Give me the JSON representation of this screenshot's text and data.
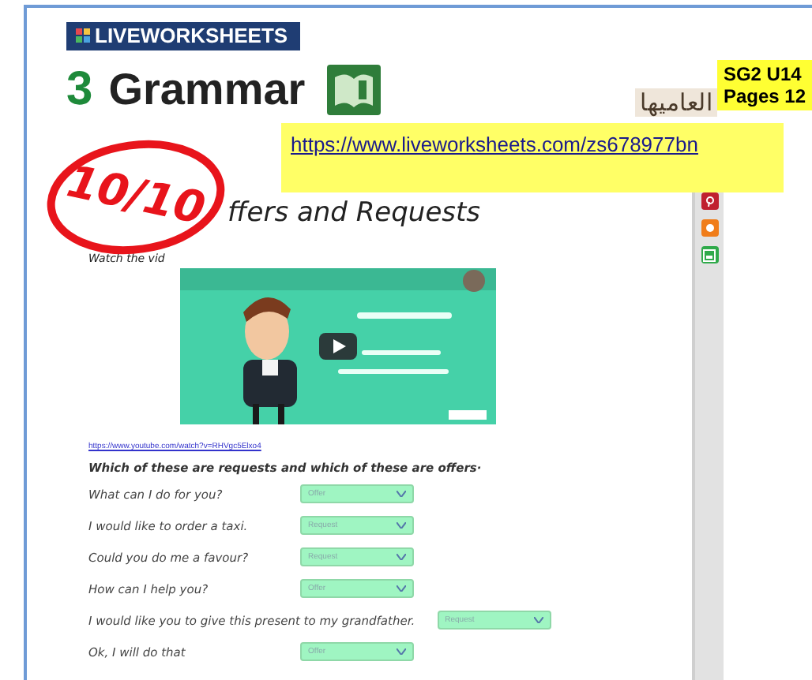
{
  "logo": "LIVEWORKSHEETS",
  "heading": {
    "number": "3",
    "title": "Grammar"
  },
  "arabic_label": "العاميها",
  "note": [
    "SG2 U14",
    "Pages 12"
  ],
  "link": "https://www.liveworksheets.com/zs678977bn",
  "score": "10/10",
  "worksheet": {
    "title": "ffers and Requests",
    "instruction": "Watch the vid",
    "video_link": "https://www.youtube.com/watch?v=RHVgc5Elxo4",
    "question": "Which of these are requests and which of these are offers·",
    "items": [
      {
        "sentence": "What can I do for you?",
        "answer": "Offer"
      },
      {
        "sentence": "I would like to order a taxi.",
        "answer": "Request"
      },
      {
        "sentence": "Could you do me a favour?",
        "answer": "Request"
      },
      {
        "sentence": "How can I help you?",
        "answer": "Offer"
      },
      {
        "sentence": "I would like you to give this present to my grandfather.",
        "answer": "Request"
      },
      {
        "sentence": "Ok, I will do that",
        "answer": "Offer"
      }
    ]
  },
  "sidebar": {
    "icons": [
      {
        "kind": "pin",
        "color": "#c0202f"
      },
      {
        "kind": "blog",
        "color": "#f07d1a"
      },
      {
        "kind": "classroom",
        "color": "#2faa4a"
      }
    ]
  }
}
